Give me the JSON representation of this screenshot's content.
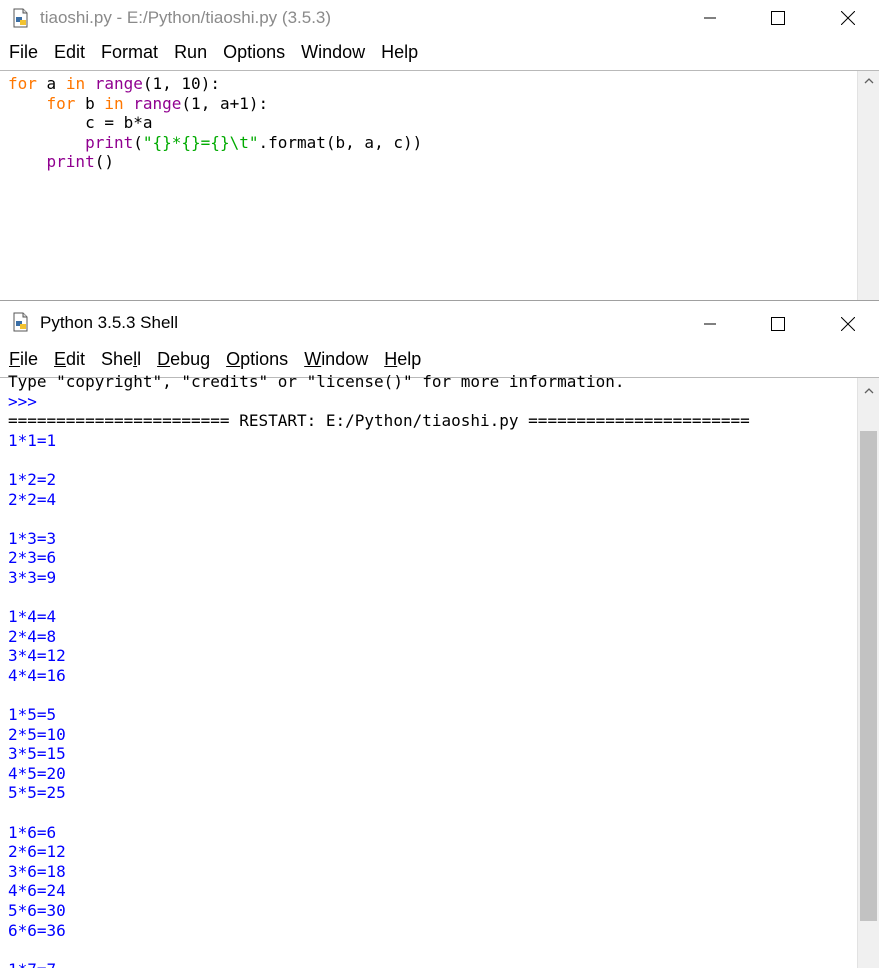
{
  "editor": {
    "title": "tiaoshi.py - E:/Python/tiaoshi.py (3.5.3)",
    "menu": [
      "File",
      "Edit",
      "Format",
      "Run",
      "Options",
      "Window",
      "Help"
    ]
  },
  "shell": {
    "title": "Python 3.5.3 Shell",
    "menu": [
      {
        "pre": "",
        "u": "F",
        "post": "ile"
      },
      {
        "pre": "",
        "u": "E",
        "post": "dit"
      },
      {
        "pre": "She",
        "u": "l",
        "post": "l"
      },
      {
        "pre": "",
        "u": "D",
        "post": "ebug"
      },
      {
        "pre": "",
        "u": "O",
        "post": "ptions"
      },
      {
        "pre": "",
        "u": "W",
        "post": "indow"
      },
      {
        "pre": "",
        "u": "H",
        "post": "elp"
      }
    ],
    "info_line": "Type \"copyright\", \"credits\" or \"license()\" for more information.",
    "prompt": ">>>",
    "restart_line": "======================= RESTART: E:/Python/tiaoshi.py =======================",
    "output_lines": [
      "1*1=1",
      "",
      "1*2=2",
      "2*2=4",
      "",
      "1*3=3",
      "2*3=6",
      "3*3=9",
      "",
      "1*4=4",
      "2*4=8",
      "3*4=12",
      "4*4=16",
      "",
      "1*5=5",
      "2*5=10",
      "3*5=15",
      "4*5=20",
      "5*5=25",
      "",
      "1*6=6",
      "2*6=12",
      "3*6=18",
      "4*6=24",
      "5*6=30",
      "6*6=36",
      "",
      "1*7=7"
    ]
  },
  "icons": {
    "app": "python-file-icon",
    "minimize": "minimize-icon",
    "maximize": "maximize-icon",
    "close": "close-icon",
    "scroll_up": "chevron-up-icon"
  },
  "colors": {
    "keyword": "#ff7700",
    "builtin": "#900090",
    "string": "#00aa00",
    "output": "#0000ff"
  }
}
